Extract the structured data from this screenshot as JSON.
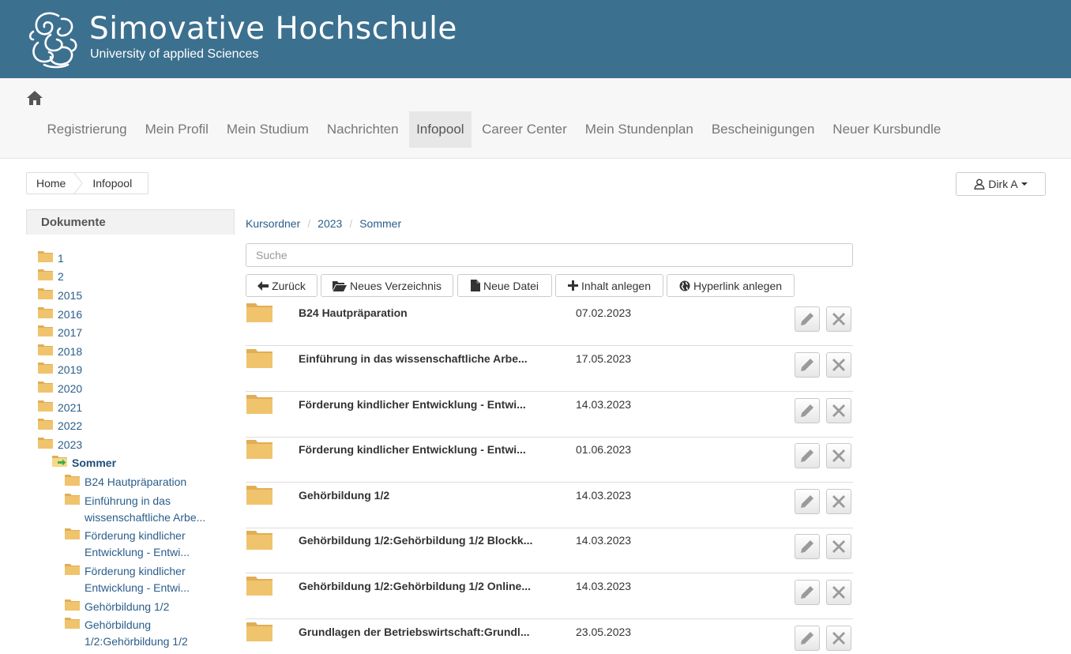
{
  "header": {
    "title": "Simovative Hochschule",
    "subtitle": "University of applied Sciences",
    "bg_color": "#3c708f"
  },
  "nav": {
    "home_icon": "home-icon",
    "items": [
      {
        "label": "Registrierung"
      },
      {
        "label": "Mein Profil"
      },
      {
        "label": "Mein Studium"
      },
      {
        "label": "Nachrichten"
      },
      {
        "label": "Infopool",
        "active": true
      },
      {
        "label": "Career Center"
      },
      {
        "label": "Mein Stundenplan"
      },
      {
        "label": "Bescheinigungen"
      },
      {
        "label": "Neuer Kursbundle"
      }
    ]
  },
  "breadcrumb": {
    "home": "Home",
    "current": "Infopool"
  },
  "user": {
    "name": "Dirk A",
    "icon": "user-icon"
  },
  "sidebar": {
    "title": "Dokumente",
    "folders": [
      "1",
      "2",
      "2015",
      "2016",
      "2017",
      "2018",
      "2019",
      "2020",
      "2021",
      "2022",
      "2023"
    ],
    "current": "Sommer",
    "children": [
      {
        "lines": [
          "B24 Hautpräparation"
        ]
      },
      {
        "lines": [
          "Einführung in das",
          "wissenschaftliche Arbe..."
        ]
      },
      {
        "lines": [
          "Förderung kindlicher",
          "Entwicklung - Entwi..."
        ]
      },
      {
        "lines": [
          "Förderung kindlicher",
          "Entwicklung - Entwi..."
        ]
      },
      {
        "lines": [
          "Gehörbildung 1/2"
        ]
      },
      {
        "lines": [
          "Gehörbildung",
          "1/2:Gehörbildung 1/2"
        ]
      }
    ]
  },
  "path": [
    "Kursordner",
    "2023",
    "Sommer"
  ],
  "search": {
    "placeholder": "Suche",
    "value": ""
  },
  "toolbar": {
    "back": "Zurück",
    "new_dir": "Neues Verzeichnis",
    "new_file": "Neue Datei",
    "add_content": "Inhalt anlegen",
    "add_link": "Hyperlink anlegen"
  },
  "rows": [
    {
      "name": "B24 Hautpräparation",
      "date": "07.02.2023"
    },
    {
      "name": "Einführung in das wissenschaftliche Arbe...",
      "date": "17.05.2023"
    },
    {
      "name": "Förderung kindlicher Entwicklung - Entwi...",
      "date": "14.03.2023"
    },
    {
      "name": "Förderung kindlicher Entwicklung - Entwi...",
      "date": "01.06.2023"
    },
    {
      "name": "Gehörbildung 1/2",
      "date": "14.03.2023"
    },
    {
      "name": "Gehörbildung 1/2:Gehörbildung 1/2 Blockk...",
      "date": "14.03.2023"
    },
    {
      "name": "Gehörbildung 1/2:Gehörbildung 1/2 Online...",
      "date": "14.03.2023"
    },
    {
      "name": "Grundlagen der Betriebswirtschaft:Grundl...",
      "date": "23.05.2023"
    }
  ],
  "colors": {
    "link": "#2a5d8a",
    "folder": "#f0c36d"
  }
}
